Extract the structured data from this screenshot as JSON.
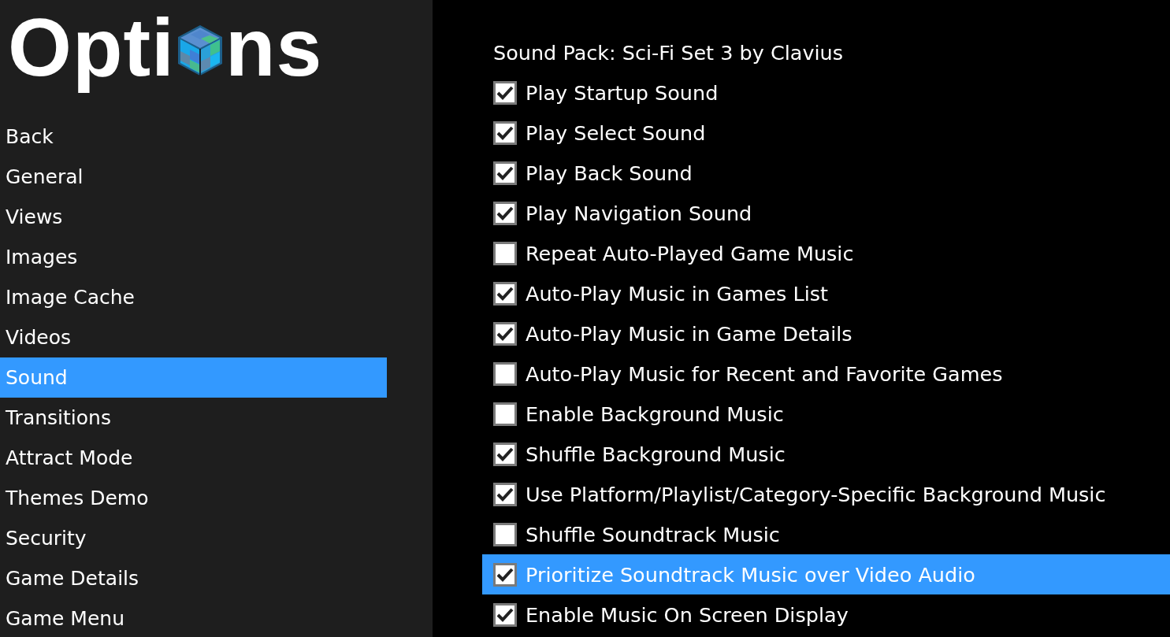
{
  "logo": {
    "before": "Opti",
    "after": "ns"
  },
  "sidebar": {
    "items": [
      {
        "label": "Back",
        "selected": false
      },
      {
        "label": "General",
        "selected": false
      },
      {
        "label": "Views",
        "selected": false
      },
      {
        "label": "Images",
        "selected": false
      },
      {
        "label": "Image Cache",
        "selected": false
      },
      {
        "label": "Videos",
        "selected": false
      },
      {
        "label": "Sound",
        "selected": true
      },
      {
        "label": "Transitions",
        "selected": false
      },
      {
        "label": "Attract Mode",
        "selected": false
      },
      {
        "label": "Themes Demo",
        "selected": false
      },
      {
        "label": "Security",
        "selected": false
      },
      {
        "label": "Game Details",
        "selected": false
      },
      {
        "label": "Game Menu",
        "selected": false
      }
    ]
  },
  "settings": [
    {
      "kind": "text",
      "label": "Sound Pack: Sci-Fi Set 3 by Clavius",
      "selected": false
    },
    {
      "kind": "checkbox",
      "label": "Play Startup Sound",
      "checked": true,
      "selected": false
    },
    {
      "kind": "checkbox",
      "label": "Play Select Sound",
      "checked": true,
      "selected": false
    },
    {
      "kind": "checkbox",
      "label": "Play Back Sound",
      "checked": true,
      "selected": false
    },
    {
      "kind": "checkbox",
      "label": "Play Navigation Sound",
      "checked": true,
      "selected": false
    },
    {
      "kind": "checkbox",
      "label": "Repeat Auto-Played Game Music",
      "checked": false,
      "selected": false
    },
    {
      "kind": "checkbox",
      "label": "Auto-Play Music in Games List",
      "checked": true,
      "selected": false
    },
    {
      "kind": "checkbox",
      "label": "Auto-Play Music in Game Details",
      "checked": true,
      "selected": false
    },
    {
      "kind": "checkbox",
      "label": "Auto-Play Music for Recent and Favorite Games",
      "checked": false,
      "selected": false
    },
    {
      "kind": "checkbox",
      "label": "Enable Background Music",
      "checked": false,
      "selected": false
    },
    {
      "kind": "checkbox",
      "label": "Shuffle Background Music",
      "checked": true,
      "selected": false
    },
    {
      "kind": "checkbox",
      "label": "Use Platform/Playlist/Category-Specific Background Music",
      "checked": true,
      "selected": false
    },
    {
      "kind": "checkbox",
      "label": "Shuffle Soundtrack Music",
      "checked": false,
      "selected": false
    },
    {
      "kind": "checkbox",
      "label": "Prioritize Soundtrack Music over Video Audio",
      "checked": true,
      "selected": true
    },
    {
      "kind": "checkbox",
      "label": "Enable Music On Screen Display",
      "checked": true,
      "selected": false
    }
  ]
}
